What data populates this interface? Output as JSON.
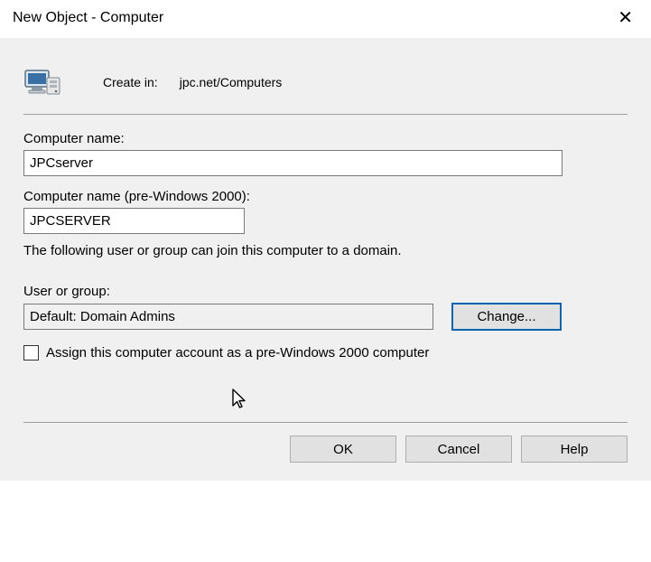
{
  "window": {
    "title": "New Object - Computer"
  },
  "header": {
    "create_in_label": "Create in:",
    "create_in_path": "jpc.net/Computers"
  },
  "fields": {
    "computer_name_label": "Computer name:",
    "computer_name_value": "JPCserver",
    "pre2000_label": "Computer name (pre-Windows 2000):",
    "pre2000_value": "JPCSERVER",
    "join_info": "The following user or group can join this computer to a domain.",
    "user_group_label": "User or group:",
    "user_group_value": "Default: Domain Admins",
    "change_btn": "Change...",
    "assign_checkbox_label": "Assign this computer account as a pre-Windows 2000 computer"
  },
  "buttons": {
    "ok": "OK",
    "cancel": "Cancel",
    "help": "Help"
  }
}
